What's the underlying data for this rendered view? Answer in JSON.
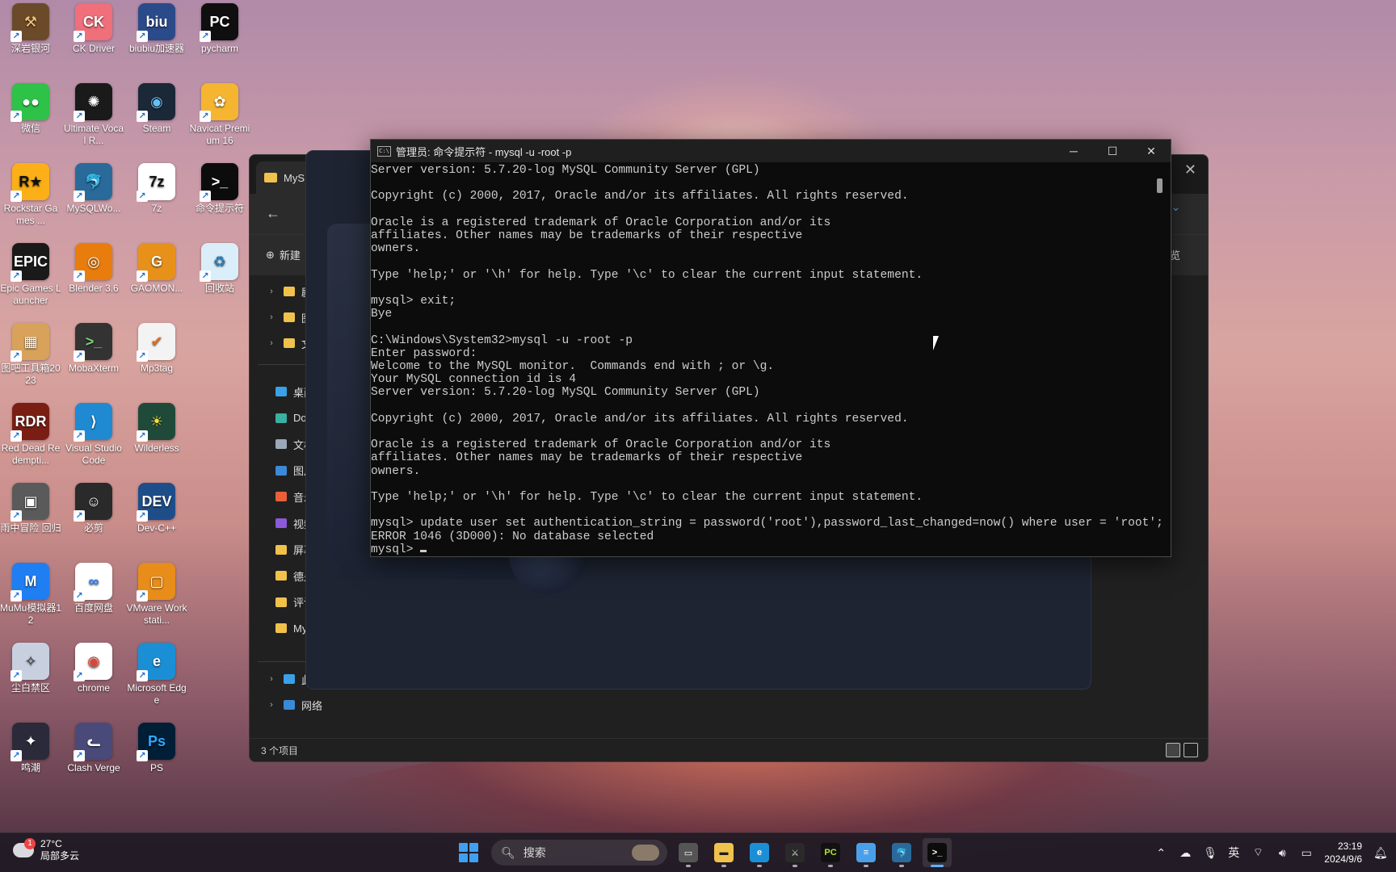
{
  "desktop_icons": [
    {
      "label": "深岩银河",
      "glyph": "⚒",
      "bg": "#6b4a2a",
      "fg": "#f2c27a",
      "x": 0,
      "y": 0
    },
    {
      "label": "CK Driver",
      "glyph": "CK",
      "bg": "#ef6f7a",
      "fg": "#ffffff",
      "x": 1,
      "y": 0
    },
    {
      "label": "biubiu加速器",
      "glyph": "biu",
      "bg": "#2b4a8a",
      "fg": "#ffffff",
      "x": 2,
      "y": 0
    },
    {
      "label": "pycharm",
      "glyph": "PC",
      "bg": "#0f0f0f",
      "fg": "#ffffff",
      "x": 3,
      "y": 0
    },
    {
      "label": "微信",
      "glyph": "●●",
      "bg": "#2ec248",
      "fg": "#ffffff",
      "x": 0,
      "y": 1
    },
    {
      "label": "Ultimate Vocal R...",
      "glyph": "✺",
      "bg": "#1a1a1a",
      "fg": "#ffffff",
      "x": 1,
      "y": 1
    },
    {
      "label": "Steam",
      "glyph": "◉",
      "bg": "#1b2838",
      "fg": "#66c0f4",
      "x": 2,
      "y": 1
    },
    {
      "label": "Navicat Premium 16",
      "glyph": "✿",
      "bg": "#f5b530",
      "fg": "#ffffff",
      "x": 3,
      "y": 1
    },
    {
      "label": "Rockstar Games ...",
      "glyph": "R★",
      "bg": "#fcaf17",
      "fg": "#111111",
      "x": 0,
      "y": 2
    },
    {
      "label": "MySQLWo...",
      "glyph": "🐬",
      "bg": "#2a6a9a",
      "fg": "#ffffff",
      "x": 1,
      "y": 2
    },
    {
      "label": "7z",
      "glyph": "7z",
      "bg": "#ffffff",
      "fg": "#111111",
      "x": 2,
      "y": 2
    },
    {
      "label": "命令提示符",
      "glyph": ">_",
      "bg": "#0c0c0c",
      "fg": "#ffffff",
      "x": 3,
      "y": 2
    },
    {
      "label": "Epic Games Launcher",
      "glyph": "EPIC",
      "bg": "#1a1a1a",
      "fg": "#ffffff",
      "x": 0,
      "y": 3
    },
    {
      "label": "Blender 3.6",
      "glyph": "◎",
      "bg": "#e87d0d",
      "fg": "#ffffff",
      "x": 1,
      "y": 3
    },
    {
      "label": "GAOMON...",
      "glyph": "G",
      "bg": "#e8911a",
      "fg": "#ffffff",
      "x": 2,
      "y": 3
    },
    {
      "label": "回收站",
      "glyph": "♻",
      "bg": "#d9eef8",
      "fg": "#2a7ab8",
      "x": 3,
      "y": 3
    },
    {
      "label": "图吧工具箱2023",
      "glyph": "▦",
      "bg": "#d8a25a",
      "fg": "#ffffff",
      "x": 0,
      "y": 4
    },
    {
      "label": "MobaXterm",
      "glyph": ">_",
      "bg": "#333333",
      "fg": "#7ad07a",
      "x": 1,
      "y": 4
    },
    {
      "label": "Mp3tag",
      "glyph": "✔",
      "bg": "#f3f3f3",
      "fg": "#e46a1a",
      "x": 2,
      "y": 4
    },
    {
      "label": "Red Dead Redempti...",
      "glyph": "RDR",
      "bg": "#7a1e14",
      "fg": "#ffffff",
      "x": 0,
      "y": 5
    },
    {
      "label": "Visual Studio Code",
      "glyph": "⟩",
      "bg": "#1f8ad2",
      "fg": "#ffffff",
      "x": 1,
      "y": 5
    },
    {
      "label": "Wilderless",
      "glyph": "☀",
      "bg": "#1f4a3a",
      "fg": "#f6e23a",
      "x": 2,
      "y": 5
    },
    {
      "label": "雨中冒险 回归",
      "glyph": "▣",
      "bg": "#5a5a5a",
      "fg": "#ffffff",
      "x": 0,
      "y": 6
    },
    {
      "label": "必剪",
      "glyph": "☺",
      "bg": "#2a2a2a",
      "fg": "#ffffff",
      "x": 1,
      "y": 6
    },
    {
      "label": "Dev-C++",
      "glyph": "DEV",
      "bg": "#1e4e8a",
      "fg": "#ffffff",
      "x": 2,
      "y": 6
    },
    {
      "label": "MuMu模拟器12",
      "glyph": "M",
      "bg": "#1e7ef2",
      "fg": "#ffffff",
      "x": 0,
      "y": 7
    },
    {
      "label": "百度网盘",
      "glyph": "∞",
      "bg": "#ffffff",
      "fg": "#2a7cf0",
      "x": 1,
      "y": 7
    },
    {
      "label": "VMware Workstati...",
      "glyph": "▢",
      "bg": "#e88c1a",
      "fg": "#ffffff",
      "x": 2,
      "y": 7
    },
    {
      "label": "尘白禁区",
      "glyph": "✧",
      "bg": "#c8d0e0",
      "fg": "#333333",
      "x": 0,
      "y": 8
    },
    {
      "label": "chrome",
      "glyph": "◉",
      "bg": "#ffffff",
      "fg": "#db4437",
      "x": 1,
      "y": 8
    },
    {
      "label": "Microsoft Edge",
      "glyph": "e",
      "bg": "#1b8fd6",
      "fg": "#ffffff",
      "x": 2,
      "y": 8
    },
    {
      "label": "鸣潮",
      "glyph": "✦",
      "bg": "#2a2a3a",
      "fg": "#ffffff",
      "x": 0,
      "y": 9
    },
    {
      "label": "Clash Verge",
      "glyph": "ᓚ",
      "bg": "#4a4a7a",
      "fg": "#ffffff",
      "x": 1,
      "y": 9
    },
    {
      "label": "PS",
      "glyph": "Ps",
      "bg": "#001e36",
      "fg": "#31a8ff",
      "x": 2,
      "y": 9
    }
  ],
  "explorer": {
    "tab_label": "MyS",
    "new_label": "新建",
    "preview_label": "预览",
    "tree": [
      {
        "label": "剧",
        "kind": "folder",
        "chev": true
      },
      {
        "label": "图",
        "kind": "folder",
        "chev": true
      },
      {
        "label": "文",
        "kind": "folder",
        "chev": true
      }
    ],
    "quick": [
      {
        "label": "桌面",
        "color": "#3aa0e8"
      },
      {
        "label": "Do",
        "color": "#3ab0a0"
      },
      {
        "label": "文档",
        "color": "#9aa8b8"
      },
      {
        "label": "图片",
        "color": "#3a8ad8"
      },
      {
        "label": "音乐",
        "color": "#e8603a"
      },
      {
        "label": "视频",
        "color": "#8a5ad8"
      },
      {
        "label": "屏幕",
        "color": "#f0c24b"
      },
      {
        "label": "德是",
        "color": "#f0c24b"
      },
      {
        "label": "评论",
        "color": "#f0c24b"
      },
      {
        "label": "My",
        "color": "#f0c24b"
      }
    ],
    "bottom_nav": [
      {
        "label": "此电",
        "color": "#3aa0e8"
      },
      {
        "label": "网络",
        "color": "#3a8ad8"
      }
    ],
    "status_count": "3 个项目"
  },
  "terminal": {
    "title": "管理员: 命令提示符 - mysql  -u -root -p",
    "lines": [
      "Server version: 5.7.20-log MySQL Community Server (GPL)",
      "",
      "Copyright (c) 2000, 2017, Oracle and/or its affiliates. All rights reserved.",
      "",
      "Oracle is a registered trademark of Oracle Corporation and/or its",
      "affiliates. Other names may be trademarks of their respective",
      "owners.",
      "",
      "Type 'help;' or '\\h' for help. Type '\\c' to clear the current input statement.",
      "",
      "mysql> exit;",
      "Bye",
      "",
      "C:\\Windows\\System32>mysql -u -root -p",
      "Enter password:",
      "Welcome to the MySQL monitor.  Commands end with ; or \\g.",
      "Your MySQL connection id is 4",
      "Server version: 5.7.20-log MySQL Community Server (GPL)",
      "",
      "Copyright (c) 2000, 2017, Oracle and/or its affiliates. All rights reserved.",
      "",
      "Oracle is a registered trademark of Oracle Corporation and/or its",
      "affiliates. Other names may be trademarks of their respective",
      "owners.",
      "",
      "Type 'help;' or '\\h' for help. Type '\\c' to clear the current input statement.",
      "",
      "mysql> update user set authentication_string = password('root'),password_last_changed=now() where user = 'root';",
      "ERROR 1046 (3D000): No database selected"
    ],
    "prompt": "mysql> "
  },
  "taskbar": {
    "weather_temp": "27°C",
    "weather_desc": "局部多云",
    "weather_badge": "1",
    "search_placeholder": "搜索",
    "apps": [
      {
        "name": "task-view",
        "glyph": "▭",
        "bg": "#555555",
        "fg": "#ffffff",
        "active": false
      },
      {
        "name": "file-explorer",
        "glyph": "▬",
        "bg": "#f0c24b",
        "fg": "#1a1a1a",
        "active": false
      },
      {
        "name": "edge",
        "glyph": "e",
        "bg": "#1b8fd6",
        "fg": "#ffffff",
        "active": false
      },
      {
        "name": "game",
        "glyph": "⚔",
        "bg": "#2a2a2a",
        "fg": "#dddddd",
        "active": false
      },
      {
        "name": "pycharm",
        "glyph": "PC",
        "bg": "#111111",
        "fg": "#b6e33a",
        "active": false
      },
      {
        "name": "notepad",
        "glyph": "≡",
        "bg": "#4aa0e8",
        "fg": "#ffffff",
        "active": false
      },
      {
        "name": "mysql-workbench",
        "glyph": "🐬",
        "bg": "#2a6a9a",
        "fg": "#ffffff",
        "active": false
      },
      {
        "name": "command-prompt",
        "glyph": ">_",
        "bg": "#0c0c0c",
        "fg": "#ffffff",
        "active": true
      }
    ],
    "ime": "英",
    "time": "23:19",
    "date": "2024/9/6"
  }
}
